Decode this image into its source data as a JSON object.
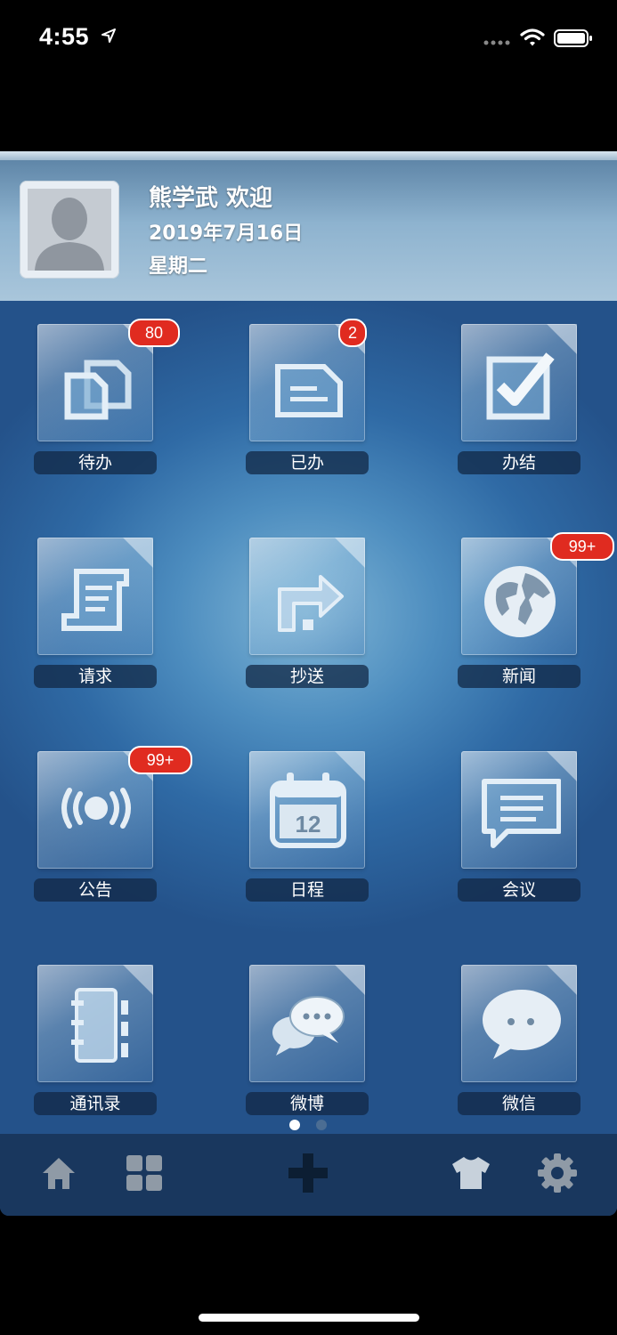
{
  "status_bar": {
    "time": "4:55"
  },
  "header": {
    "greeting": "熊学武 欢迎",
    "date": "2019年7月16日",
    "weekday": "星期二"
  },
  "tiles": [
    {
      "label": "待办",
      "badge": "80",
      "icon": "documents-icon"
    },
    {
      "label": "已办",
      "badge": "2",
      "icon": "document-icon"
    },
    {
      "label": "办结",
      "badge": "",
      "icon": "checkbox-icon"
    },
    {
      "label": "请求",
      "badge": "",
      "icon": "request-icon"
    },
    {
      "label": "抄送",
      "badge": "",
      "icon": "forward-arrow-icon"
    },
    {
      "label": "新闻",
      "badge": "99+",
      "icon": "globe-icon"
    },
    {
      "label": "公告",
      "badge": "99+",
      "icon": "broadcast-icon"
    },
    {
      "label": "日程",
      "badge": "",
      "icon": "calendar-icon",
      "calendar_day": "12"
    },
    {
      "label": "会议",
      "badge": "",
      "icon": "message-box-icon"
    },
    {
      "label": "通讯录",
      "badge": "",
      "icon": "address-book-icon"
    },
    {
      "label": "微博",
      "badge": "",
      "icon": "chat-bubbles-icon"
    },
    {
      "label": "微信",
      "badge": "",
      "icon": "speech-bubble-icon"
    }
  ],
  "page_dots": {
    "count": 2,
    "active": 0
  },
  "tab_bar": [
    "home-icon",
    "grid-icon",
    "plus-icon",
    "tshirt-icon",
    "gear-icon"
  ],
  "colors": {
    "badge": "#e02b20",
    "label_bg": "#14283f",
    "tabbar": "#19375e"
  }
}
